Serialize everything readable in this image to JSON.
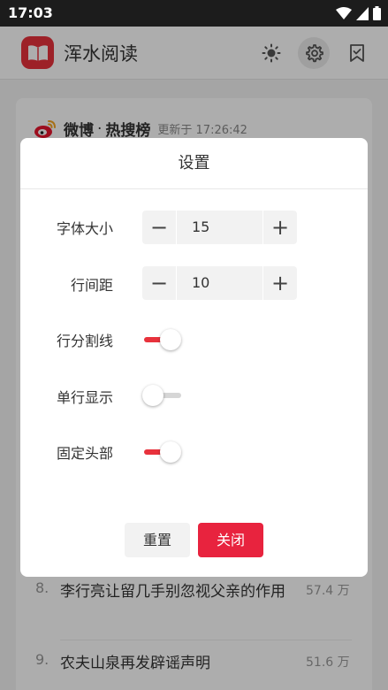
{
  "status_bar": {
    "time": "17:03"
  },
  "app": {
    "title": "浑水阅读"
  },
  "card": {
    "source": "微博",
    "separator": "·",
    "list_name": "热搜榜",
    "updated": "更新于 17:26:42",
    "items": [
      {
        "rank": "8.",
        "text": "李行亮让留几手别忽视父亲的作用",
        "count": "57.4 万"
      },
      {
        "rank": "9.",
        "text": "农夫山泉再发辟谣声明",
        "count": "51.6 万"
      }
    ]
  },
  "dialog": {
    "title": "设置",
    "font_size": {
      "label": "字体大小",
      "value": "15",
      "minus": "−",
      "plus": "+"
    },
    "line_spacing": {
      "label": "行间距",
      "value": "10",
      "minus": "−",
      "plus": "+"
    },
    "row_divider": {
      "label": "行分割线",
      "on": true
    },
    "single_line": {
      "label": "单行显示",
      "on": false
    },
    "fixed_header": {
      "label": "固定头部",
      "on": true
    },
    "reset_label": "重置",
    "close_label": "关闭"
  },
  "colors": {
    "accent": "#e8233e",
    "logo": "#e8323c"
  }
}
